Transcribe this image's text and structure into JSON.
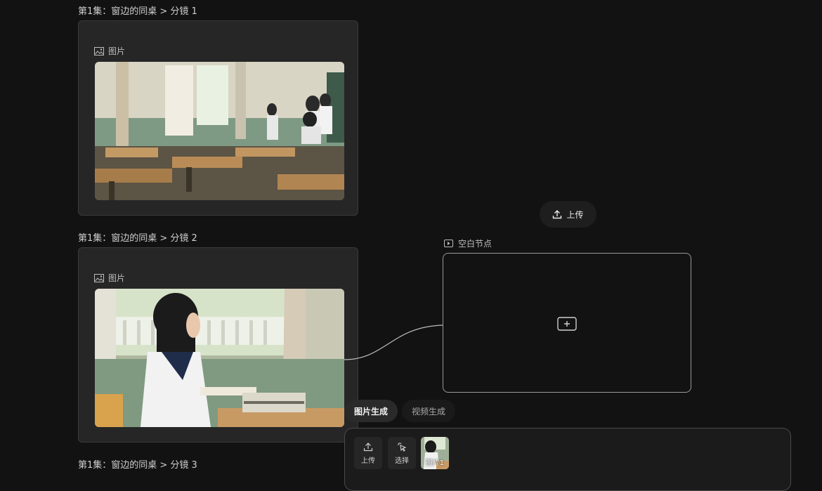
{
  "shots": [
    {
      "breadcrumb": "第1集：窗边的同桌 > 分镜 1",
      "card_label": "图片"
    },
    {
      "breadcrumb": "第1集：窗边的同桌 > 分镜 2",
      "card_label": "图片"
    },
    {
      "breadcrumb": "第1集：窗边的同桌 > 分镜 3"
    }
  ],
  "upload_button": {
    "label": "上传",
    "icon": "upload-icon"
  },
  "blank_node": {
    "title": "空白节点",
    "icon": "video-icon",
    "add_icon": "plus-icon"
  },
  "tabs": [
    {
      "label": "图片生成",
      "active": true
    },
    {
      "label": "视频生成",
      "active": false
    }
  ],
  "panel": {
    "tools": [
      {
        "label": "上传",
        "icon": "upload-icon"
      },
      {
        "label": "选择",
        "icon": "cursor-click-icon"
      }
    ],
    "attachment": {
      "label": "图片1"
    }
  },
  "colors": {
    "background": "#121212",
    "card": "#262626",
    "border": "#3a3a3a"
  }
}
